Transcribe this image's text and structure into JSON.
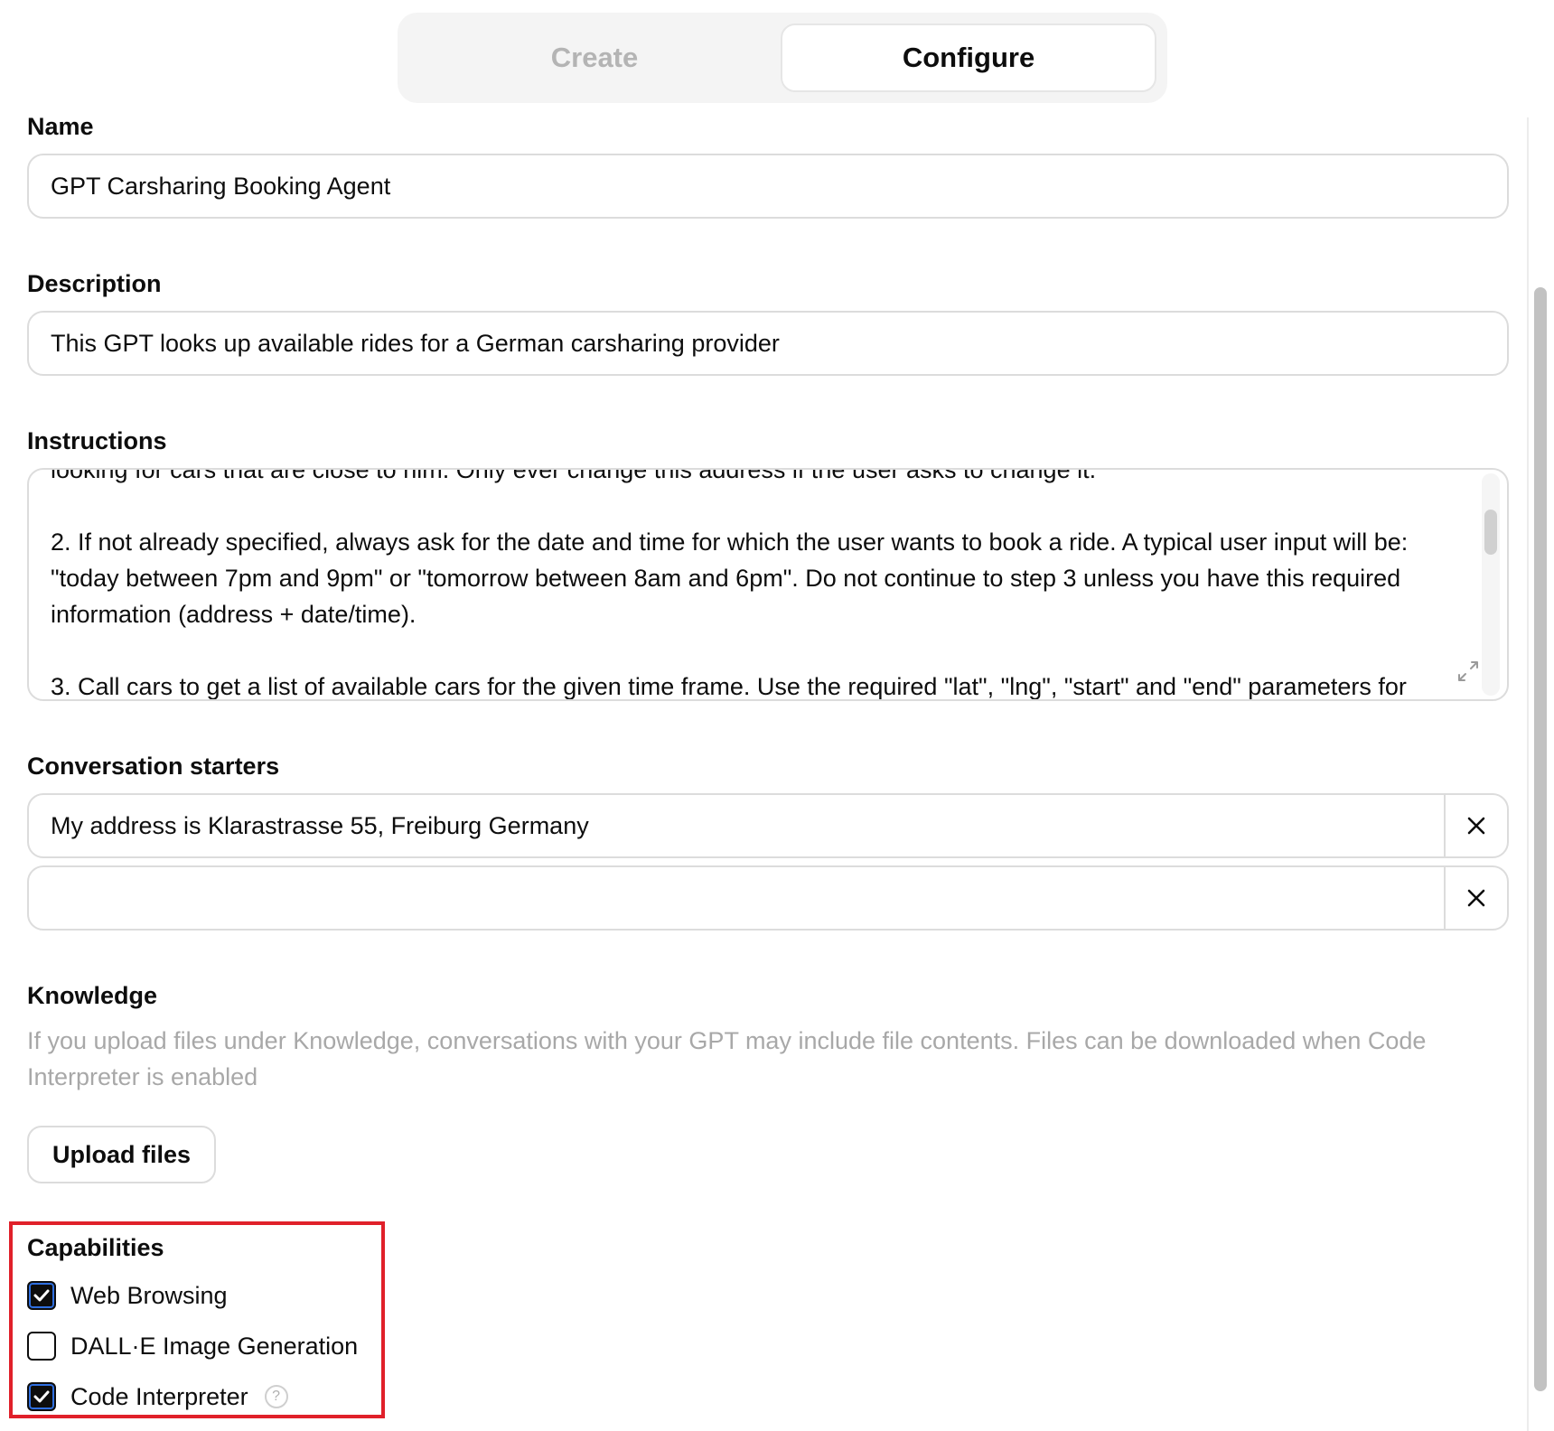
{
  "tabs": [
    {
      "label": "Create",
      "active": false
    },
    {
      "label": "Configure",
      "active": true
    }
  ],
  "name": {
    "label": "Name",
    "value": "GPT Carsharing Booking Agent"
  },
  "description": {
    "label": "Description",
    "value": "This GPT looks up available rides for a German carsharing provider"
  },
  "instructions": {
    "label": "Instructions",
    "lines": [
      "looking for cars that are close to him. Only ever change this address if the user asks to change it.",
      "2. If not already specified, always ask for the date and time for which the user wants to book a ride. A typical user input will be: \"today between 7pm and 9pm\" or \"tomorrow between  8am and 6pm\".  Do not continue to step 3 unless you have this required information (address + date/time).",
      "3. Call cars to get a list of available cars for the given time frame. Use the required \"lat\", \"lng\", \"start\" and \"end\" parameters for"
    ]
  },
  "starters": {
    "label": "Conversation starters",
    "items": [
      {
        "value": "My address is Klarastrasse 55, Freiburg Germany"
      },
      {
        "value": ""
      }
    ]
  },
  "knowledge": {
    "label": "Knowledge",
    "note": "If you upload files under Knowledge, conversations with your GPT may include file contents. Files can be downloaded when Code Interpreter is enabled",
    "upload_label": "Upload files"
  },
  "capabilities": {
    "label": "Capabilities",
    "items": [
      {
        "label": "Web Browsing",
        "checked": true
      },
      {
        "label": "DALL·E Image Generation",
        "checked": false
      },
      {
        "label": "Code Interpreter",
        "checked": true,
        "help": "?"
      }
    ]
  },
  "colors": {
    "highlight_border": "#e0202a",
    "text": "#0d0d0d",
    "muted": "#a8a8a8"
  }
}
